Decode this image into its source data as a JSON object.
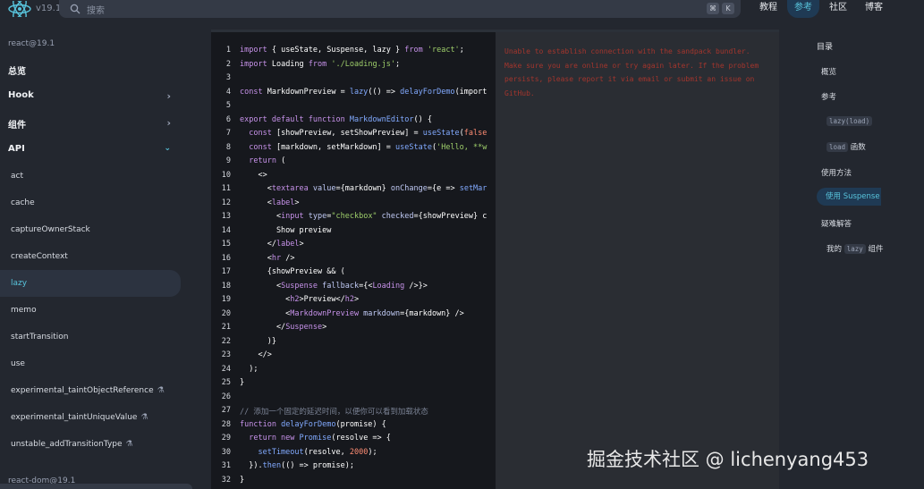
{
  "header": {
    "version": "v19.1",
    "search_placeholder": "搜索",
    "kbd1": "⌘",
    "kbd2": "K",
    "nav": [
      "教程",
      "参考",
      "社区",
      "博客"
    ]
  },
  "sidebar": {
    "pkg_react": "react@19.1",
    "overview": "总览",
    "hook": "Hook",
    "components": "组件",
    "api": "API",
    "items": [
      "act",
      "cache",
      "captureOwnerStack",
      "createContext",
      "lazy",
      "memo",
      "startTransition",
      "use",
      "experimental_taintObjectReference",
      "experimental_taintUniqueValue",
      "unstable_addTransitionType"
    ],
    "pkg_react_dom": "react-dom@19.1"
  },
  "code": {
    "line_numbers": [
      "1",
      "2",
      "3",
      "4",
      "5",
      "6",
      "7",
      "8",
      "9",
      "10",
      "11",
      "12",
      "13",
      "14",
      "15",
      "16",
      "17",
      "18",
      "19",
      "20",
      "21",
      "22",
      "23",
      "24",
      "25",
      "26",
      "27",
      "28",
      "29",
      "30",
      "31",
      "32"
    ],
    "l1a": "import",
    "l1b": " { useState, Suspense, lazy } ",
    "l1c": "from",
    "l1d": " 'react'",
    "l1e": ";",
    "l2a": "import",
    "l2b": " Loading ",
    "l2c": "from",
    "l2d": " './Loading.js'",
    "l2e": ";",
    "l4a": "const",
    "l4b": " MarkdownPreview = ",
    "l4c": "lazy",
    "l4d": "(() => ",
    "l4e": "delayForDemo",
    "l4f": "(import",
    "l6a": "export default function",
    "l6b": " MarkdownEditor",
    "l6c": "() {",
    "l7a": "  const",
    "l7b": " [showPreview, setShowPreview] = ",
    "l7c": "useState",
    "l7d": "(",
    "l7e": "false",
    "l8a": "  const",
    "l8b": " [markdown, setMarkdown] = ",
    "l8c": "useState",
    "l8d": "(",
    "l8e": "'Hello, **w",
    "l9a": "  return",
    "l9b": " (",
    "l10": "    <>",
    "l11a": "      <",
    "l11b": "textarea",
    "l11c": " value",
    "l11d": "={markdown} ",
    "l11e": "onChange",
    "l11f": "={e => ",
    "l11g": "setMar",
    "l12a": "      <",
    "l12b": "label",
    "l12c": ">",
    "l13a": "        <",
    "l13b": "input",
    "l13c": " type",
    "l13d": "=",
    "l13e": "\"checkbox\"",
    "l13f": " checked",
    "l13g": "={showPreview} c",
    "l14": "        Show preview",
    "l15a": "      </",
    "l15b": "label",
    "l15c": ">",
    "l16a": "      <",
    "l16b": "hr",
    "l16c": " />",
    "l17": "      {showPreview && (",
    "l18a": "        <",
    "l18b": "Suspense",
    "l18c": " fallback",
    "l18d": "={<",
    "l18e": "Loading",
    "l18f": " />}>",
    "l19a": "          <",
    "l19b": "h2",
    "l19c": ">Preview</",
    "l19d": "h2",
    "l19e": ">",
    "l20a": "          <",
    "l20b": "MarkdownPreview",
    "l20c": " markdown",
    "l20d": "={markdown} />",
    "l21a": "        </",
    "l21b": "Suspense",
    "l21c": ">",
    "l22": "      )}",
    "l23": "    </>",
    "l24": "  );",
    "l25": "}",
    "l27": "// 添加一个固定的延迟时间，以便你可以看到加载状态",
    "l28a": "function",
    "l28b": " delayForDemo",
    "l28c": "(promise) {",
    "l29a": "  return new",
    "l29b": " Promise",
    "l29c": "(resolve => {",
    "l30a": "    setTimeout",
    "l30b": "(resolve, ",
    "l30c": "2000",
    "l30d": ");",
    "l31a": "  }).",
    "l31b": "then",
    "l31c": "(() => promise);",
    "l32": "}"
  },
  "preview": {
    "error_text": "Unable to establish connection with the sandpack bundler. Make sure you are online or try again later. If the problem persists, please report it via email or submit an issue on GitHub."
  },
  "toc": {
    "title": "目录",
    "overview": "概览",
    "reference": "参考",
    "lazy_chip": "lazy(load)",
    "load_chip": "load",
    "load_label": "函数",
    "usage": "使用方法",
    "use_suspense": "使用 Suspense",
    "troubleshoot": "疑难解答",
    "my_prefix": "我的",
    "my_chip": "lazy",
    "my_suffix": "组件"
  },
  "watermark": "掘金技术社区 @ lichenyang453",
  "colors": {
    "accent": "#58c4dc",
    "bg": "#23272f",
    "code_bg": "#16181d",
    "error": "#b8372c"
  }
}
